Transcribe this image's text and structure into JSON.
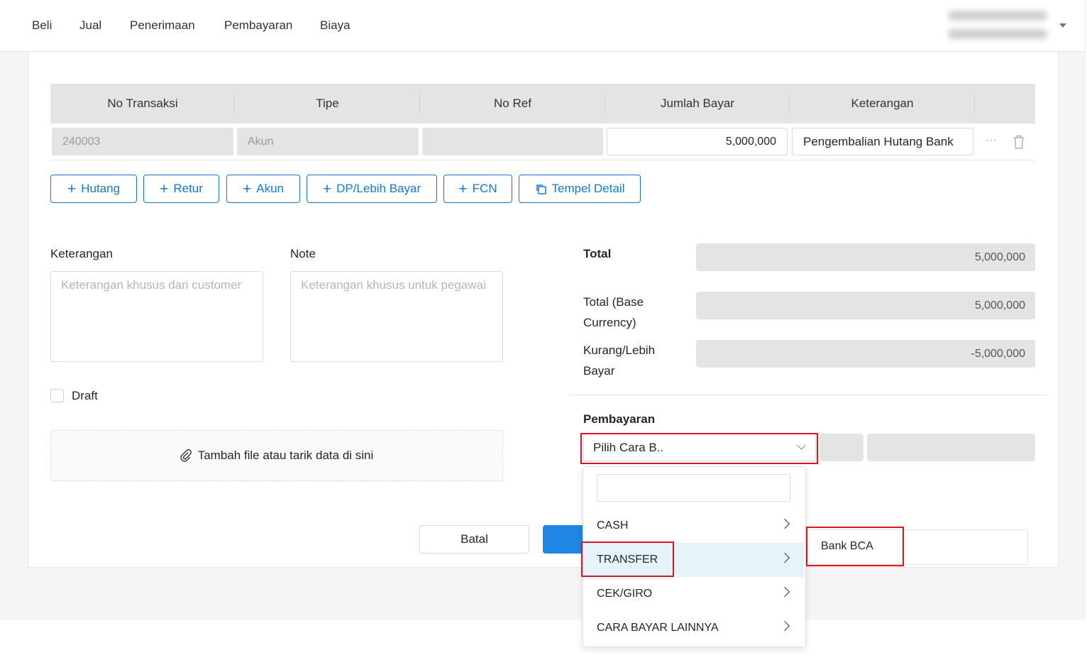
{
  "nav": {
    "items": [
      "Beli",
      "Jual",
      "Penerimaan",
      "Pembayaran",
      "Biaya"
    ]
  },
  "table": {
    "headers": [
      "No Transaksi",
      "Tipe",
      "No Ref",
      "Jumlah Bayar",
      "Keterangan"
    ],
    "row": {
      "no_transaksi": "240003",
      "tipe": "Akun",
      "no_ref": "",
      "jumlah_bayar": "5,000,000",
      "keterangan": "Pengembalian Hutang Bank"
    }
  },
  "add_buttons": {
    "hutang": "Hutang",
    "retur": "Retur",
    "akun": "Akun",
    "dp": "DP/Lebih Bayar",
    "fcn": "FCN",
    "tempel": "Tempel Detail"
  },
  "form": {
    "keterangan_label": "Keterangan",
    "keterangan_placeholder": "Keterangan khusus dari customer",
    "note_label": "Note",
    "note_placeholder": "Keterangan khusus untuk pegawai",
    "draft_label": "Draft",
    "dropzone_text": "Tambah file atau tarik data di sini"
  },
  "summary": {
    "total_label": "Total",
    "total_value": "5,000,000",
    "total_base_label_1": "Total (Base",
    "total_base_label_2": "Currency)",
    "total_base_value": "5,000,000",
    "kurang_label_1": "Kurang/Lebih",
    "kurang_label_2": "Bayar",
    "kurang_value": "-5,000,000"
  },
  "payment": {
    "label": "Pembayaran",
    "select_value": "Pilih Cara B..",
    "search_value": "",
    "options": [
      "CASH",
      "TRANSFER",
      "CEK/GIRO",
      "CARA BAYAR LAINNYA"
    ],
    "submenu_option": "Bank BCA"
  },
  "actions": {
    "cancel": "Batal"
  },
  "colors": {
    "primary": "#1677d2",
    "highlight_box": "#e0141e",
    "selected_row_bg": "#e6f4f9"
  }
}
